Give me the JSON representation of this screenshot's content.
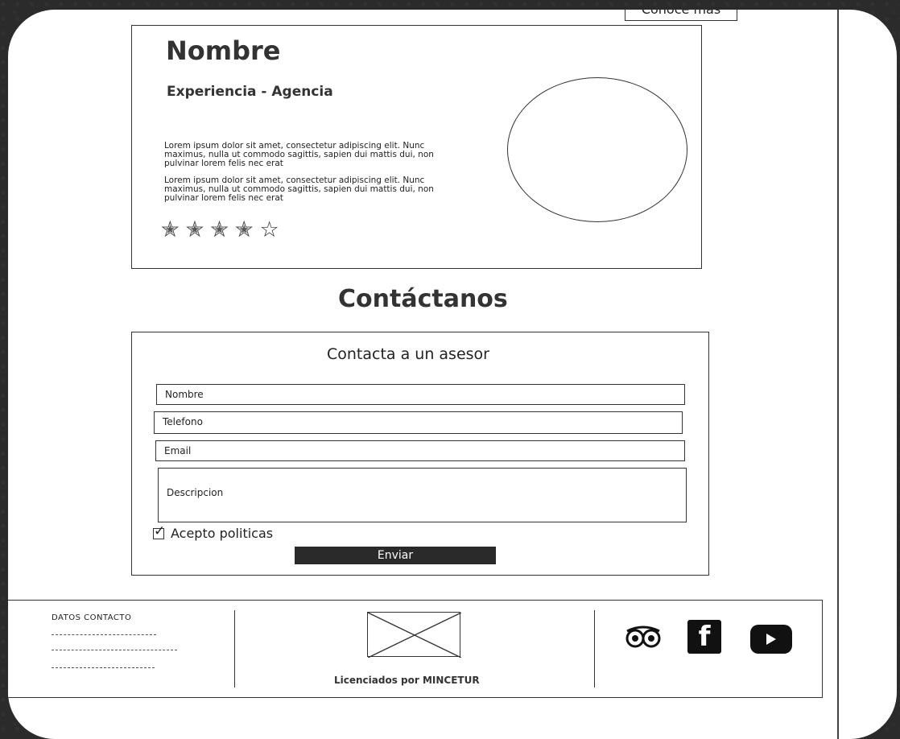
{
  "header": {
    "top_button_label": "Conoce más"
  },
  "profile": {
    "name": "Nombre",
    "subtitle": "Experiencia - Agencia",
    "paragraphs": [
      "Lorem ipsum dolor sit amet, consectetur adipiscing elit. Nunc maximus, nulla ut commodo sagittis, sapien dui mattis dui, non pulvinar lorem felis nec erat",
      "Lorem ipsum dolor sit amet, consectetur adipiscing elit. Nunc maximus, nulla ut commodo sagittis, sapien dui mattis dui, non pulvinar lorem felis nec erat"
    ],
    "rating": {
      "value": 4,
      "max": 5
    }
  },
  "contact": {
    "section_title": "Contáctanos",
    "form_title": "Contacta a un asesor",
    "fields": {
      "name": "Nombre",
      "phone": "Telefono",
      "email": "Email",
      "description": "Descripcion"
    },
    "accept_label": "Acepto politicas",
    "accept_checked": true,
    "submit_label": "Enviar"
  },
  "footer": {
    "contact_title": "DATOS CONTACTO",
    "license_text": "Licenciados por MINCETUR",
    "social_icons": [
      "tripadvisor-icon",
      "facebook-icon",
      "youtube-icon"
    ],
    "facebook_glyph": "f"
  }
}
